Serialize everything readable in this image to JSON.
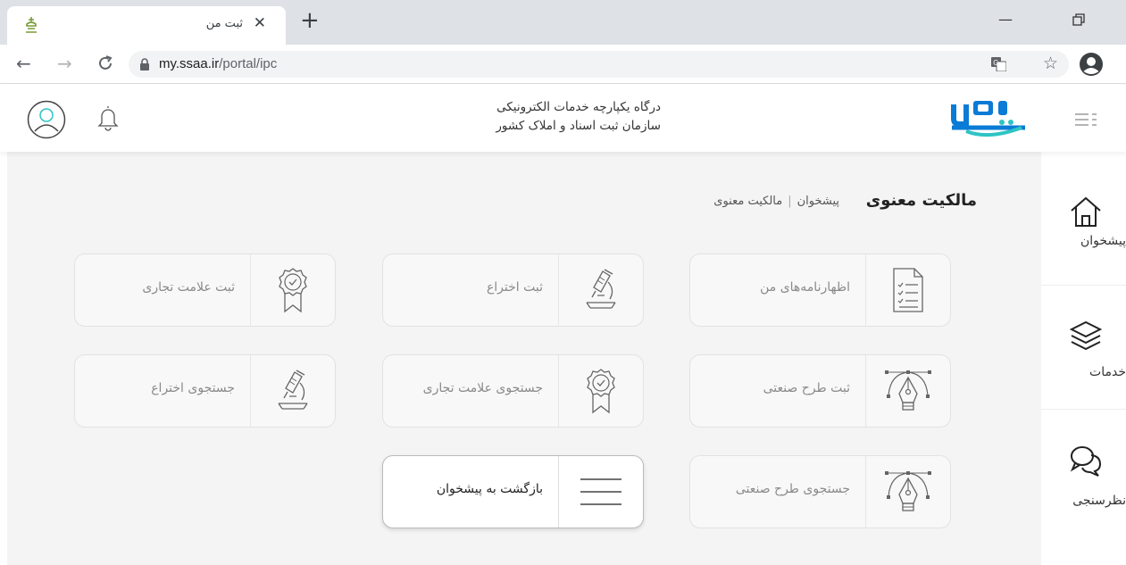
{
  "browser": {
    "tab_title": "ثبت من",
    "tab_close": "✕",
    "new_tab": "+",
    "url_host": "my.ssaa.ir",
    "url_path": "/portal/ipc",
    "window_min": "—"
  },
  "header": {
    "line1": "درگاه یکپارچه خدمات الکترونیکی",
    "line2": "سازمان ثبت اسناد و املاک کشور",
    "logo_color": "#0a7bd6",
    "accent_color": "#2ec4c4"
  },
  "page": {
    "title": "مالکیت معنوی",
    "breadcrumb_home": "پیشخوان",
    "breadcrumb_sep": "|",
    "breadcrumb_current": "مالکیت معنوی"
  },
  "cards": [
    {
      "label": "اظهارنامه‌های من",
      "icon": "document-checklist-icon"
    },
    {
      "label": "ثبت اختراع",
      "icon": "microscope-icon"
    },
    {
      "label": "ثبت علامت تجاری",
      "icon": "award-badge-icon"
    },
    {
      "label": "ثبت طرح صنعتی",
      "icon": "pen-tool-icon"
    },
    {
      "label": "جستجوی علامت تجاری",
      "icon": "award-badge-icon"
    },
    {
      "label": "جستجوی اختراع",
      "icon": "microscope-icon"
    },
    {
      "label": "جستجوی طرح صنعتی",
      "icon": "pen-tool-icon"
    },
    {
      "label": "بازگشت به پیشخوان",
      "icon": "hamburger-icon"
    }
  ],
  "sidenav": [
    {
      "label": "پیشخوان",
      "icon": "home-icon"
    },
    {
      "label": "خدمات",
      "icon": "layers-icon"
    },
    {
      "label": "نظرسنجی",
      "icon": "chat-bubbles-icon"
    }
  ]
}
